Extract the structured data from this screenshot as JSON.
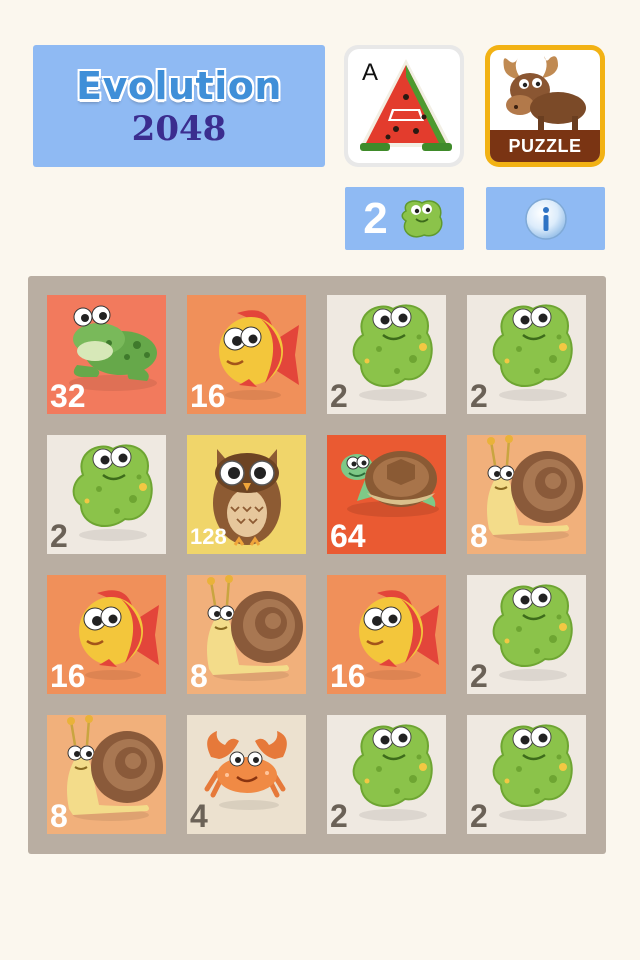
{
  "logo": {
    "title": "Evolution",
    "number": "2048"
  },
  "promo_apps": [
    {
      "letter": "A",
      "icon": "watermelon-letter-a-icon"
    },
    {
      "label": "PUZZLE",
      "icon": "moose-icon"
    }
  ],
  "next_tile": {
    "count": "2",
    "icon": "green-blob-icon"
  },
  "info_button": {
    "icon": "info-icon"
  },
  "board": {
    "rows": [
      [
        {
          "value": "32",
          "creature": "frog"
        },
        {
          "value": "16",
          "creature": "fish"
        },
        {
          "value": "2",
          "creature": "blob"
        },
        {
          "value": "2",
          "creature": "blob"
        }
      ],
      [
        {
          "value": "2",
          "creature": "blob"
        },
        {
          "value": "128",
          "creature": "owl"
        },
        {
          "value": "64",
          "creature": "turtle"
        },
        {
          "value": "8",
          "creature": "snail"
        }
      ],
      [
        {
          "value": "16",
          "creature": "fish"
        },
        {
          "value": "8",
          "creature": "snail"
        },
        {
          "value": "16",
          "creature": "fish"
        },
        {
          "value": "2",
          "creature": "blob"
        }
      ],
      [
        {
          "value": "8",
          "creature": "snail"
        },
        {
          "value": "4",
          "creature": "crab"
        },
        {
          "value": "2",
          "creature": "blob"
        },
        {
          "value": "2",
          "creature": "blob"
        }
      ]
    ]
  },
  "colors": {
    "background": "#fbf7ee",
    "panel_blue": "#8fbaf3",
    "board": "#b9aea2",
    "tile_2": "#efe9e1",
    "tile_4": "#ece1cf",
    "tile_8": "#f1b07b",
    "tile_16": "#f0905a",
    "tile_32": "#f27a5d",
    "tile_64": "#ea5a32",
    "tile_128": "#f0d56a",
    "dark_number": "#6b6257",
    "light_number": "#ffffff"
  }
}
